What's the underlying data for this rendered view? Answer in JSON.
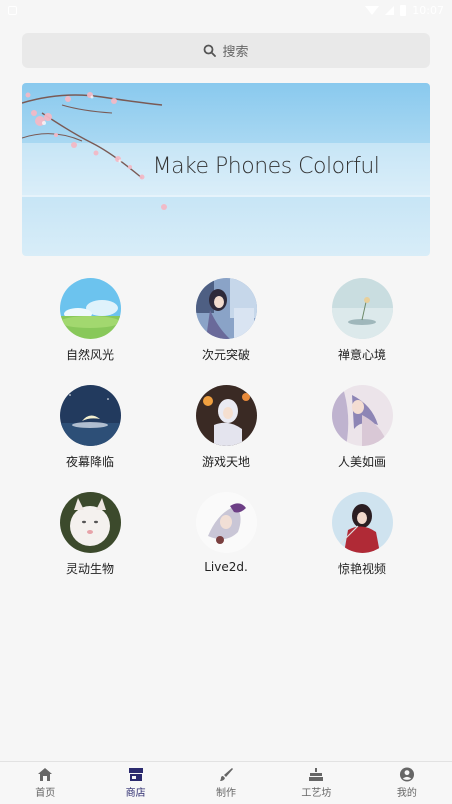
{
  "status_bar": {
    "time": "10:07"
  },
  "search": {
    "label": "搜索"
  },
  "banner": {
    "title": "Make Phones Colorful"
  },
  "categories": [
    {
      "label": "自然风光",
      "icon": "nature-thumbnail"
    },
    {
      "label": "次元突破",
      "icon": "anime-thumbnail"
    },
    {
      "label": "禅意心境",
      "icon": "zen-thumbnail"
    },
    {
      "label": "夜幕降临",
      "icon": "night-thumbnail"
    },
    {
      "label": "游戏天地",
      "icon": "game-thumbnail"
    },
    {
      "label": "人美如画",
      "icon": "portrait-thumbnail"
    },
    {
      "label": "灵动生物",
      "icon": "kitten-thumbnail"
    },
    {
      "label": "Live2d.",
      "icon": "live2d-thumbnail"
    },
    {
      "label": "惊艳视频",
      "icon": "video-thumbnail"
    }
  ],
  "tabs": [
    {
      "label": "首页",
      "icon": "home-icon"
    },
    {
      "label": "商店",
      "icon": "store-icon",
      "active": true
    },
    {
      "label": "制作",
      "icon": "brush-icon"
    },
    {
      "label": "工艺坊",
      "icon": "cake-icon"
    },
    {
      "label": "我的",
      "icon": "account-icon"
    }
  ],
  "colors": {
    "accent": "#2b2a6e",
    "background": "#f6f6f6",
    "banner_sky": "#89c9ee"
  }
}
